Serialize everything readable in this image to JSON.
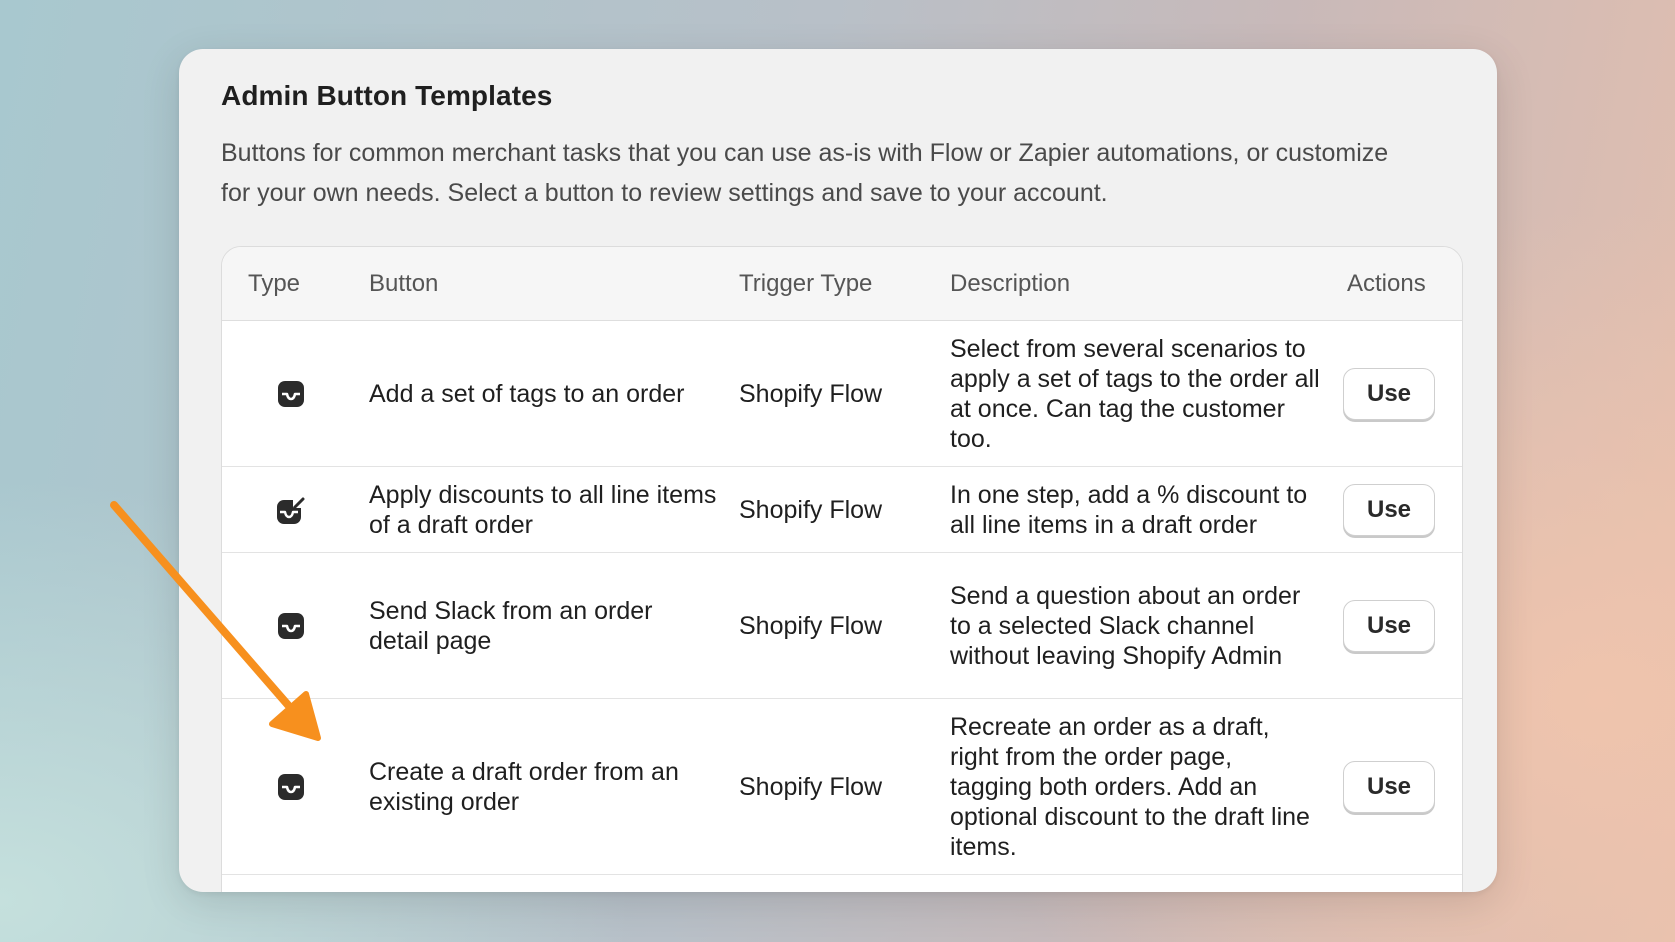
{
  "card": {
    "title": "Admin Button Templates",
    "description": "Buttons for common merchant tasks that you can use as-is with Flow or Zapier automations, or customize for your own needs. Select a button to review settings and save to your account."
  },
  "table": {
    "headers": {
      "type": "Type",
      "button": "Button",
      "trigger": "Trigger Type",
      "description": "Description",
      "actions": "Actions"
    },
    "rows": [
      {
        "icon": "inbox-tray-icon",
        "button": "Add a set of tags to an order",
        "trigger": "Shopify Flow",
        "description": "Select from several scenarios to apply a set of tags to the order all at once. Can tag the customer too.",
        "action": "Use"
      },
      {
        "icon": "edit-tray-icon",
        "button": "Apply discounts to all line items of a draft order",
        "trigger": "Shopify Flow",
        "description": "In one step, add a % discount to all line items in a draft order",
        "action": "Use"
      },
      {
        "icon": "inbox-tray-icon",
        "button": "Send Slack from an order detail page",
        "trigger": "Shopify Flow",
        "description": "Send a question about an order to a selected Slack channel without leaving Shopify Admin",
        "action": "Use"
      },
      {
        "icon": "inbox-tray-icon",
        "button": "Create a draft order from an existing order",
        "trigger": "Shopify Flow",
        "description": "Recreate an order as a draft, right from the order page, tagging both orders. Add an optional discount to the draft line items.",
        "action": "Use"
      }
    ]
  },
  "annotation": {
    "arrow_color": "#f7901e",
    "arrow_icon": "arrow-annotation-icon"
  }
}
